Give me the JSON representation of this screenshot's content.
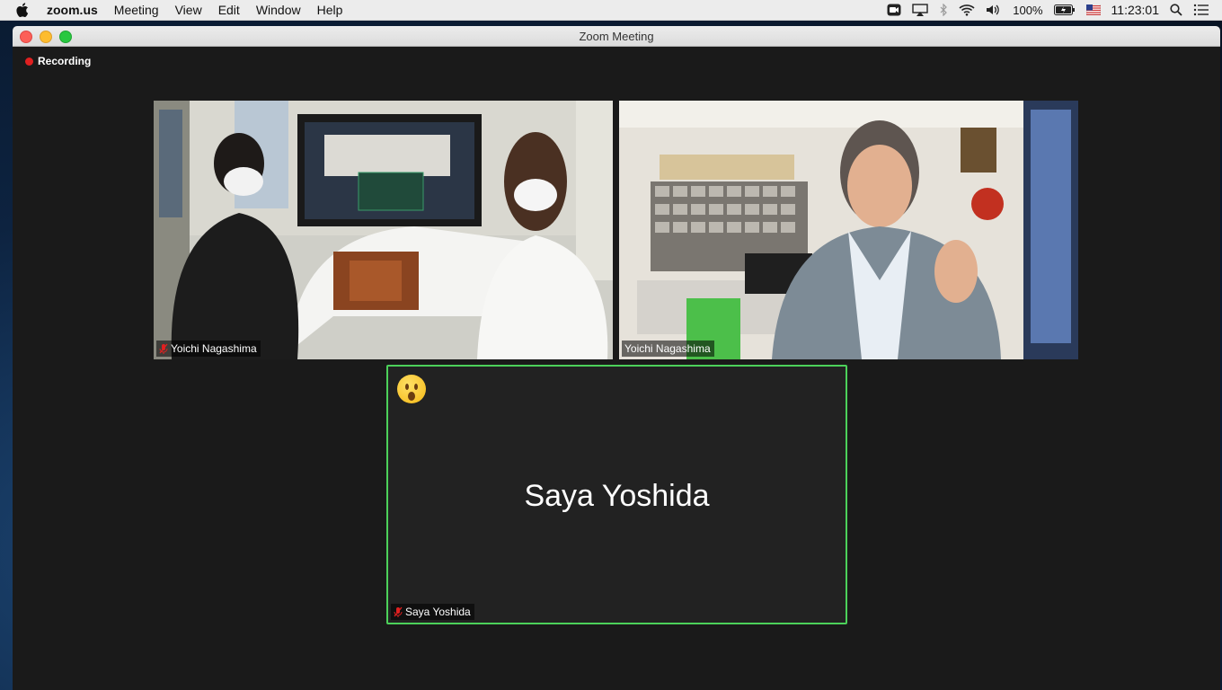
{
  "menubar": {
    "app": "zoom.us",
    "items": [
      "Meeting",
      "View",
      "Edit",
      "Window",
      "Help"
    ],
    "battery": "100%",
    "clock": "11:23:01"
  },
  "window": {
    "title": "Zoom Meeting",
    "recording_label": "Recording"
  },
  "participants": [
    {
      "name": "Yoichi Nagashima",
      "muted": true
    },
    {
      "name": "Yoichi Nagashima",
      "muted": false
    },
    {
      "name": "Saya Yoshida",
      "muted": true,
      "video_off": true,
      "active_speaker": true
    }
  ],
  "colors": {
    "active_speaker_border": "#4cd15a",
    "recording_dot": "#e02020",
    "muted_icon": "#e02020"
  }
}
